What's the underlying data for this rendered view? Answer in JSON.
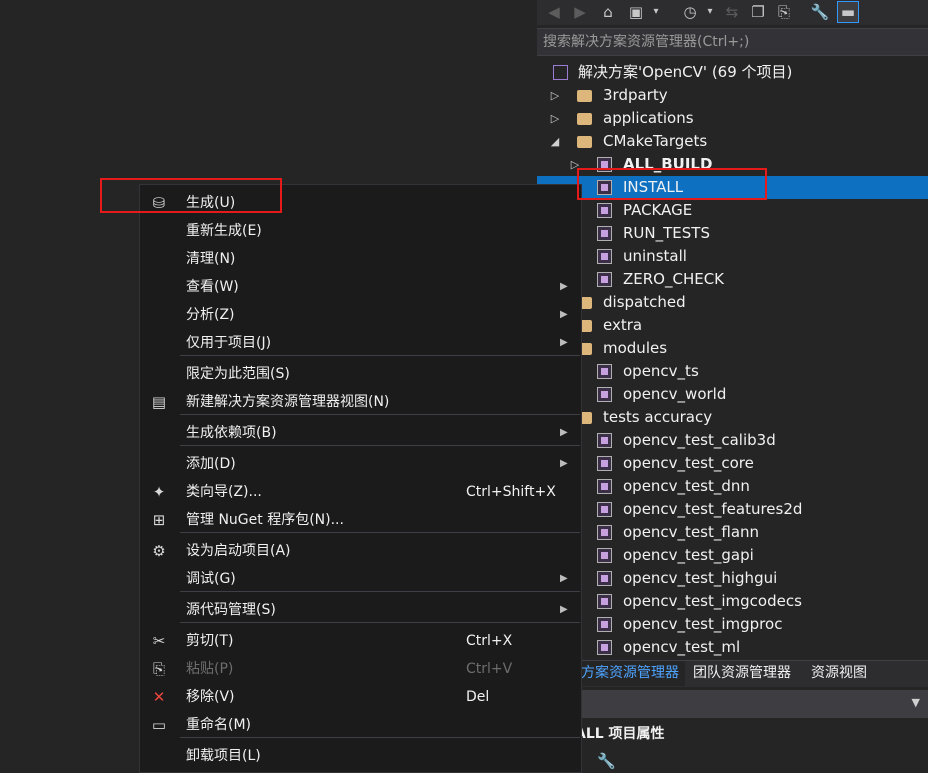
{
  "search": {
    "placeholder": "搜索解决方案资源管理器(Ctrl+;)"
  },
  "tree": {
    "solution": "解决方案'OpenCV' (69 个项目)",
    "items": [
      {
        "label": "3rdparty",
        "kind": "folder"
      },
      {
        "label": "applications",
        "kind": "folder"
      },
      {
        "label": "CMakeTargets",
        "kind": "folder"
      },
      {
        "label": "ALL_BUILD",
        "kind": "project"
      },
      {
        "label": "INSTALL",
        "kind": "project"
      },
      {
        "label": "PACKAGE",
        "kind": "project"
      },
      {
        "label": "RUN_TESTS",
        "kind": "project"
      },
      {
        "label": "uninstall",
        "kind": "project"
      },
      {
        "label": "ZERO_CHECK",
        "kind": "project"
      },
      {
        "label": "dispatched",
        "kind": "folder"
      },
      {
        "label": "extra",
        "kind": "folder"
      },
      {
        "label": "modules",
        "kind": "folder"
      },
      {
        "label": "opencv_ts",
        "kind": "project"
      },
      {
        "label": "opencv_world",
        "kind": "project"
      },
      {
        "label": "tests accuracy",
        "kind": "folder"
      },
      {
        "label": "opencv_test_calib3d",
        "kind": "project"
      },
      {
        "label": "opencv_test_core",
        "kind": "project"
      },
      {
        "label": "opencv_test_dnn",
        "kind": "project"
      },
      {
        "label": "opencv_test_features2d",
        "kind": "project"
      },
      {
        "label": "opencv_test_flann",
        "kind": "project"
      },
      {
        "label": "opencv_test_gapi",
        "kind": "project"
      },
      {
        "label": "opencv_test_highgui",
        "kind": "project"
      },
      {
        "label": "opencv_test_imgcodecs",
        "kind": "project"
      },
      {
        "label": "opencv_test_imgproc",
        "kind": "project"
      },
      {
        "label": "opencv_test_ml",
        "kind": "project"
      }
    ]
  },
  "tabs": [
    {
      "label": "方案资源管理器"
    },
    {
      "label": "团队资源管理器"
    },
    {
      "label": "资源视图"
    }
  ],
  "props": {
    "title": "ALL 项目属性"
  },
  "menu": {
    "items": [
      {
        "label": "生成(U)",
        "icon": "build-icon"
      },
      {
        "label": "重新生成(E)"
      },
      {
        "label": "清理(N)"
      },
      {
        "label": "查看(W)"
      },
      {
        "label": "分析(Z)"
      },
      {
        "label": "仅用于项目(J)"
      },
      {
        "label": "限定为此范围(S)"
      },
      {
        "label": "新建解决方案资源管理器视图(N)",
        "icon": "new-view-icon"
      },
      {
        "label": "生成依赖项(B)"
      },
      {
        "label": "添加(D)"
      },
      {
        "label": "类向导(Z)...",
        "shortcut": "Ctrl+Shift+X",
        "icon": "class-wizard-icon"
      },
      {
        "label": "管理 NuGet 程序包(N)...",
        "icon": "nuget-package-icon"
      },
      {
        "label": "设为启动项目(A)",
        "icon": "gear-icon"
      },
      {
        "label": "调试(G)"
      },
      {
        "label": "源代码管理(S)"
      },
      {
        "label": "剪切(T)",
        "shortcut": "Ctrl+X",
        "icon": "scissors-icon"
      },
      {
        "label": "粘贴(P)",
        "shortcut": "Ctrl+V",
        "icon": "paste-icon"
      },
      {
        "label": "移除(V)",
        "shortcut": "Del",
        "icon": "remove-x-icon"
      },
      {
        "label": "重命名(M)",
        "icon": "rename-icon"
      },
      {
        "label": "卸载项目(L)"
      }
    ]
  },
  "colors": {
    "selection": "#0e70c0",
    "highlight_box": "#e51a1a",
    "active_tab": "#4ea3ff"
  }
}
